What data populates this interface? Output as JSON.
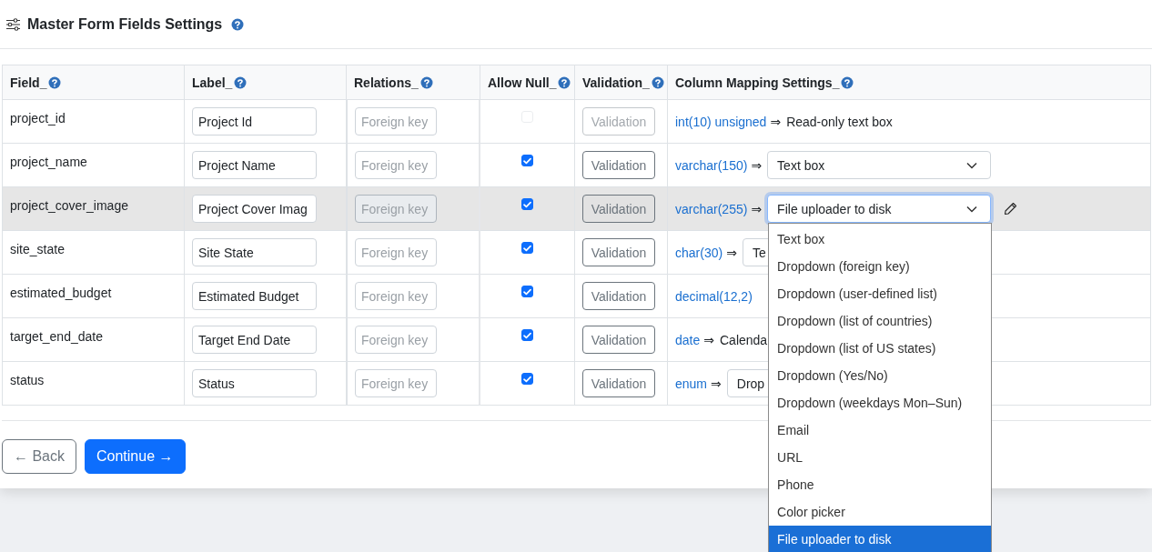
{
  "title": "Master Form Fields Settings",
  "columns": [
    {
      "label": "Field_"
    },
    {
      "label": "Label_"
    },
    {
      "label": "Relations_"
    },
    {
      "label": "Allow Null_"
    },
    {
      "label": "Validation_"
    },
    {
      "label": "Column Mapping Settings_"
    }
  ],
  "rows": [
    {
      "field": "project_id",
      "label": "Project Id",
      "relation_placeholder": "Foreign key",
      "allow_null": {
        "checked": false,
        "disabled": true
      },
      "validation": {
        "text": "Validation",
        "disabled": true
      },
      "highlighted": false,
      "mapping": {
        "type": "int(10) unsigned",
        "arrow": "⇒",
        "kind": "text",
        "value": "Read-only text box"
      }
    },
    {
      "field": "project_name",
      "label": "Project Name",
      "relation_placeholder": "Foreign key",
      "allow_null": {
        "checked": true,
        "disabled": false
      },
      "validation": {
        "text": "Validation",
        "disabled": false
      },
      "highlighted": false,
      "mapping": {
        "type": "varchar(150)",
        "arrow": "⇒",
        "kind": "select",
        "value": "Text box"
      }
    },
    {
      "field": "project_cover_image",
      "label": "Project Cover Imag",
      "relation_placeholder": "Foreign key",
      "allow_null": {
        "checked": true,
        "disabled": false
      },
      "validation": {
        "text": "Validation",
        "disabled": false
      },
      "highlighted": true,
      "mapping": {
        "type": "varchar(255)",
        "arrow": "⇒",
        "kind": "select",
        "value": "File uploader to disk",
        "open": true,
        "edit": true,
        "options": [
          {
            "label": "Text box",
            "selected": false
          },
          {
            "label": "Dropdown (foreign key)",
            "selected": false
          },
          {
            "label": "Dropdown (user-defined list)",
            "selected": false
          },
          {
            "label": "Dropdown (list of countries)",
            "selected": false
          },
          {
            "label": "Dropdown (list of US states)",
            "selected": false
          },
          {
            "label": "Dropdown (Yes/No)",
            "selected": false
          },
          {
            "label": "Dropdown (weekdays Mon–Sun)",
            "selected": false
          },
          {
            "label": "Email",
            "selected": false
          },
          {
            "label": "URL",
            "selected": false
          },
          {
            "label": "Phone",
            "selected": false
          },
          {
            "label": "Color picker",
            "selected": false
          },
          {
            "label": "File uploader to disk",
            "selected": true
          }
        ]
      }
    },
    {
      "field": "site_state",
      "label": "Site State",
      "relation_placeholder": "Foreign key",
      "allow_null": {
        "checked": true,
        "disabled": false
      },
      "validation": {
        "text": "Validation",
        "disabled": false
      },
      "highlighted": false,
      "mapping": {
        "type": "char(30)",
        "arrow": "⇒",
        "kind": "select",
        "value": "Te"
      }
    },
    {
      "field": "estimated_budget",
      "label": "Estimated Budget",
      "relation_placeholder": "Foreign key",
      "allow_null": {
        "checked": true,
        "disabled": false
      },
      "validation": {
        "text": "Validation",
        "disabled": false
      },
      "highlighted": false,
      "mapping": {
        "type": "decimal(12,2)"
      }
    },
    {
      "field": "target_end_date",
      "label": "Target End Date",
      "relation_placeholder": "Foreign key",
      "allow_null": {
        "checked": true,
        "disabled": false
      },
      "validation": {
        "text": "Validation",
        "disabled": false
      },
      "highlighted": false,
      "mapping": {
        "type": "date",
        "arrow": "⇒",
        "kind": "text",
        "value": "Calenda"
      }
    },
    {
      "field": "status",
      "label": "Status",
      "relation_placeholder": "Foreign key",
      "allow_null": {
        "checked": true,
        "disabled": false
      },
      "validation": {
        "text": "Validation",
        "disabled": false
      },
      "highlighted": false,
      "mapping": {
        "type": "enum",
        "arrow": "⇒",
        "kind": "select",
        "value": "Drop"
      }
    }
  ],
  "buttons": [
    {
      "kind": "outline",
      "label": "← Back"
    },
    {
      "kind": "primary",
      "label": "Continue →"
    }
  ]
}
